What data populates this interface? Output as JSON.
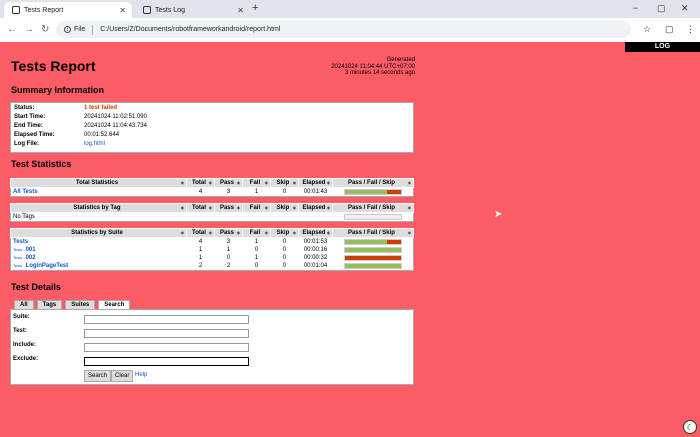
{
  "browser": {
    "tabs": [
      {
        "label": "Tests Report",
        "active": true
      },
      {
        "label": "Tests Log",
        "active": false
      }
    ],
    "new_tab": "+",
    "controls": {
      "minimize": "−",
      "maximize": "▢",
      "close": "✕"
    },
    "address": {
      "file_label": "File",
      "url": "C:/Users/Z/Documents/robotframeworkandroid/report.html"
    }
  },
  "page": {
    "log_button": "LOG",
    "title": "Tests Report",
    "generated": {
      "label": "Generated",
      "timestamp": "20241024 11:04:44 UTC+07:00",
      "ago": "3 minutes 14 seconds ago"
    },
    "summary": {
      "heading": "Summary Information",
      "rows": [
        {
          "key": "Status:",
          "value": "1 test failed"
        },
        {
          "key": "Start Time:",
          "value": "20241024 11:02:51.090"
        },
        {
          "key": "End Time:",
          "value": "20241024 11:04:43.734"
        },
        {
          "key": "Elapsed Time:",
          "value": "00:01:52.644"
        },
        {
          "key": "Log File:",
          "value": "log.html"
        }
      ]
    },
    "statistics": {
      "heading": "Test Statistics",
      "columns": [
        "Total",
        "Pass",
        "Fail",
        "Skip",
        "Elapsed",
        "Pass / Fail / Skip"
      ],
      "total": {
        "header": "Total Statistics",
        "rows": [
          {
            "name": "All Tests",
            "total": "4",
            "pass": "3",
            "fail": "1",
            "skip": "0",
            "elapsed": "00:01:43"
          }
        ]
      },
      "tag": {
        "header": "Statistics by Tag",
        "rows": [
          {
            "name": "No Tags"
          }
        ]
      },
      "suite": {
        "header": "Statistics by Suite",
        "rows": [
          {
            "prefix": "",
            "name": "Tests",
            "total": "4",
            "pass": "3",
            "fail": "1",
            "skip": "0",
            "elapsed": "00:01:53"
          },
          {
            "prefix": "Tests .",
            "name": "001",
            "total": "1",
            "pass": "1",
            "fail": "0",
            "skip": "0",
            "elapsed": "00:00:16"
          },
          {
            "prefix": "Tests .",
            "name": "002",
            "total": "1",
            "pass": "0",
            "fail": "1",
            "skip": "0",
            "elapsed": "00:00:32"
          },
          {
            "prefix": "Tests .",
            "name": "LoginPageTest",
            "total": "2",
            "pass": "2",
            "fail": "0",
            "skip": "0",
            "elapsed": "00:01:04"
          }
        ]
      },
      "colors": {
        "pass": "#97bd61",
        "fail": "#ce3e01"
      }
    },
    "details": {
      "heading": "Test Details",
      "tabs": [
        "All",
        "Tags",
        "Suites",
        "Search"
      ],
      "selected_tab": "Search",
      "fields": [
        {
          "label": "Suite:",
          "value": ""
        },
        {
          "label": "Test:",
          "value": ""
        },
        {
          "label": "Include:",
          "value": ""
        },
        {
          "label": "Exclude:",
          "value": ""
        }
      ],
      "search_button": "Search",
      "clear_button": "Clear",
      "help_link": "Help"
    },
    "background_color": "#fc5c65"
  }
}
